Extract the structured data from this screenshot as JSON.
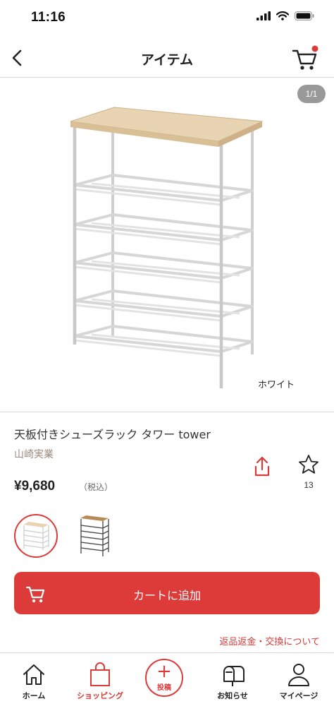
{
  "status_bar": {
    "time": "11:16"
  },
  "nav": {
    "title": "アイテム"
  },
  "gallery": {
    "page_indicator": "1/1",
    "color_caption": "ホワイト"
  },
  "product": {
    "name": "天板付きシューズラック タワー tower",
    "brand": "山崎実業",
    "price": "¥9,680",
    "tax_label": "（税込）",
    "favorite_count": "13"
  },
  "cart": {
    "add_label": "カートに追加"
  },
  "returns_link": "返品返金・交換について",
  "tabs": [
    {
      "label": "ホーム",
      "icon": "house-icon"
    },
    {
      "label": "ショッピング",
      "icon": "shopping-bag-icon",
      "active": true
    },
    {
      "label": "投稿",
      "icon": "plus-icon"
    },
    {
      "label": "お知らせ",
      "icon": "mailbox-icon"
    },
    {
      "label": "マイページ",
      "icon": "person-icon"
    }
  ],
  "colors": {
    "accent": "#dc3b39",
    "brand_text": "#9a8a7c",
    "wood": "#e8d3b2"
  }
}
